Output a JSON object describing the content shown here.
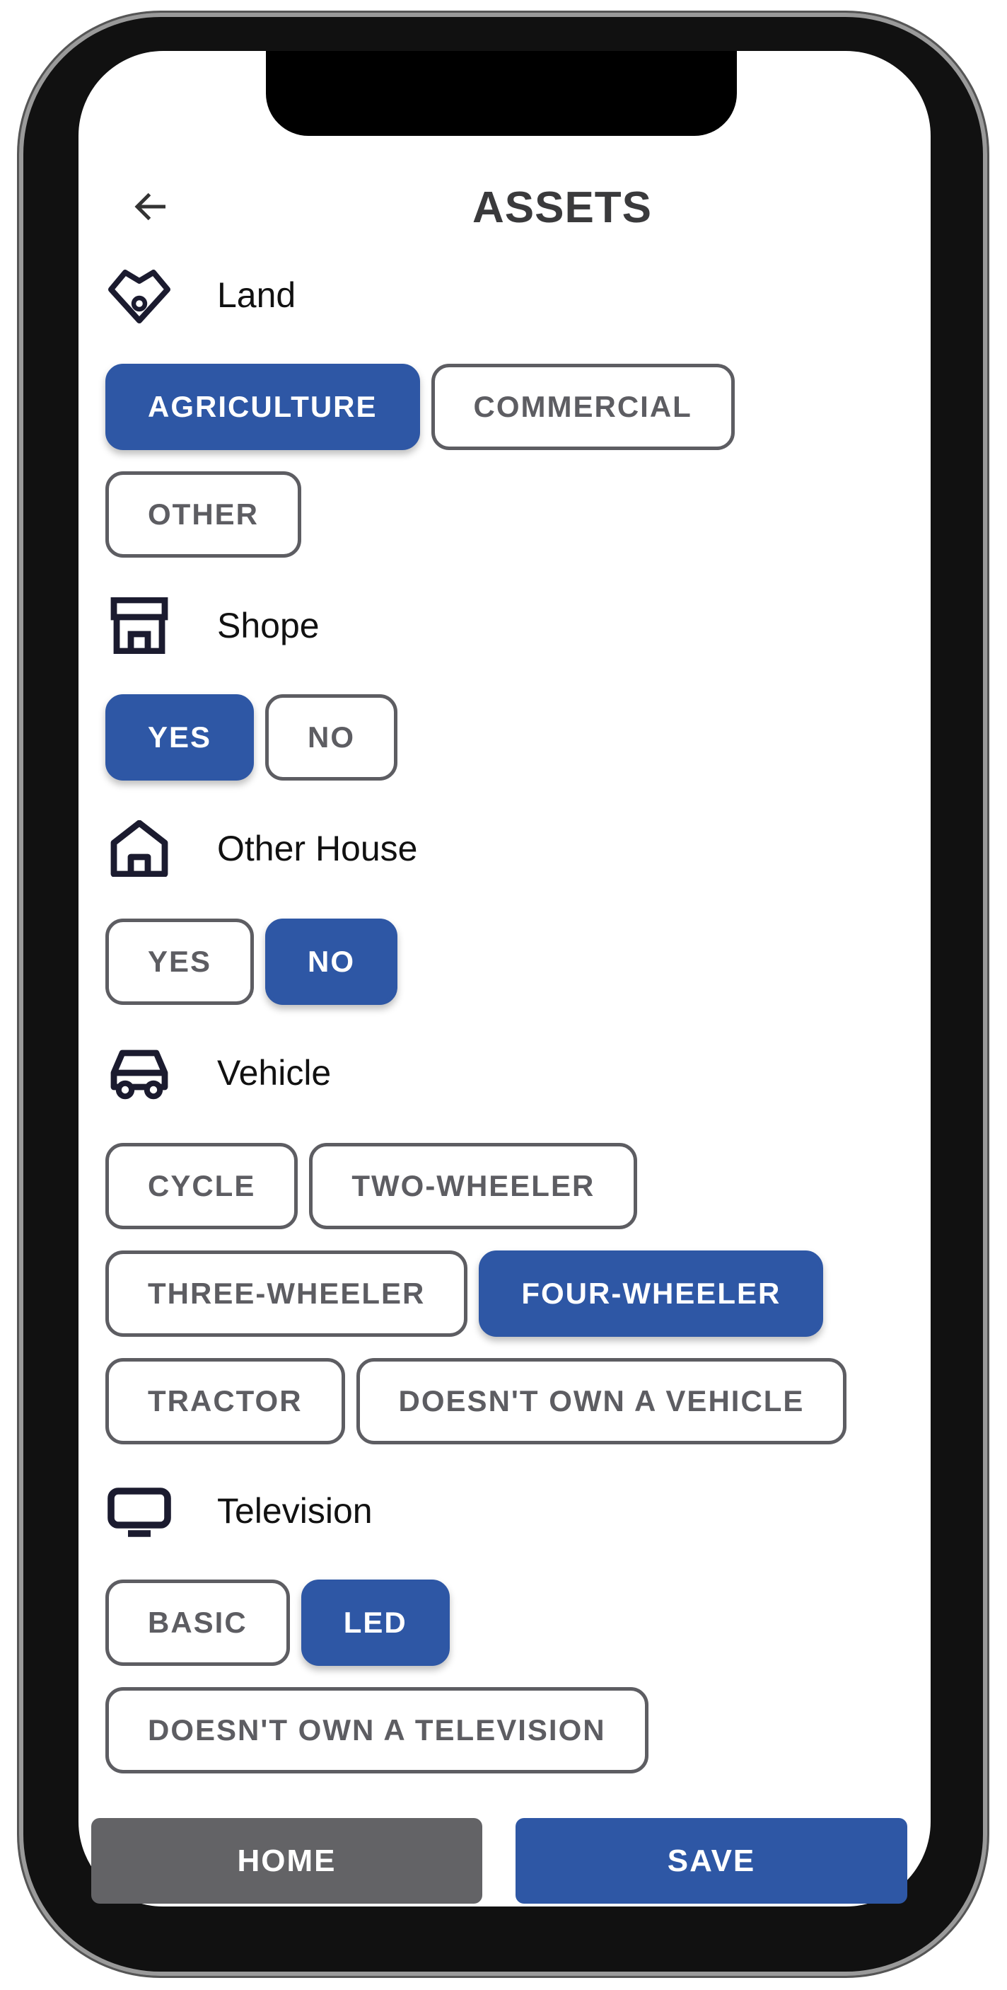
{
  "header": {
    "title": "ASSETS"
  },
  "sections": [
    {
      "label": "Land",
      "icon": "land-icon",
      "options": [
        "AGRICULTURE",
        "COMMERCIAL",
        "OTHER"
      ],
      "selected": "AGRICULTURE"
    },
    {
      "label": "Shope",
      "icon": "shop-icon",
      "options": [
        "YES",
        "NO"
      ],
      "selected": "YES"
    },
    {
      "label": "Other House",
      "icon": "house-icon",
      "options": [
        "YES",
        "NO"
      ],
      "selected": "NO"
    },
    {
      "label": "Vehicle",
      "icon": "car-icon",
      "options": [
        "CYCLE",
        "TWO-WHEELER",
        "THREE-WHEELER",
        "FOUR-WHEELER",
        "TRACTOR",
        "DOESN'T OWN A VEHICLE"
      ],
      "selected": "FOUR-WHEELER"
    },
    {
      "label": "Television",
      "icon": "tv-icon",
      "options": [
        "BASIC",
        "LED",
        "DOESN'T OWN A TELEVISION"
      ],
      "selected": "LED"
    }
  ],
  "footer": {
    "home_label": "HOME",
    "save_label": "SAVE"
  },
  "colors": {
    "accent": "#2e57a5",
    "secondary": "#636366",
    "chip_border": "#5d5d62"
  }
}
